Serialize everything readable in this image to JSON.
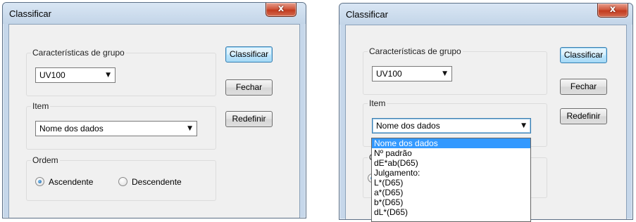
{
  "left_dialog": {
    "title": "Classificar",
    "close_label": "x",
    "group_characteristics": {
      "legend": "Características de grupo",
      "selected": "UV100"
    },
    "group_item": {
      "legend": "Item",
      "selected": "Nome dos dados"
    },
    "group_order": {
      "legend": "Ordem",
      "option_ascending": "Ascendente",
      "option_descending": "Descendente",
      "checked": "Ascendente"
    },
    "buttons": {
      "classify": "Classificar",
      "close": "Fechar",
      "reset": "Redefinir"
    }
  },
  "right_dialog": {
    "title": "Classificar",
    "close_label": "x",
    "group_characteristics": {
      "legend": "Características de grupo",
      "selected": "UV100"
    },
    "group_item": {
      "legend": "Item",
      "selected": "Nome dos dados"
    },
    "group_order_partial_legend": "O",
    "buttons": {
      "classify": "Classificar",
      "close": "Fechar",
      "reset": "Redefinir"
    },
    "dropdown_options": [
      "Nome dos dados",
      "Nº padrão",
      "dE*ab(D65)",
      "Julgamento:",
      "L*(D65)",
      "a*(D65)",
      "b*(D65)",
      "dL*(D65)"
    ],
    "dropdown_highlighted": "Nome dos dados"
  },
  "colors": {
    "frame": "#c6d7ea",
    "client": "#f0f0f0",
    "close_button": "#c23b1f",
    "highlight": "#3399ff"
  }
}
